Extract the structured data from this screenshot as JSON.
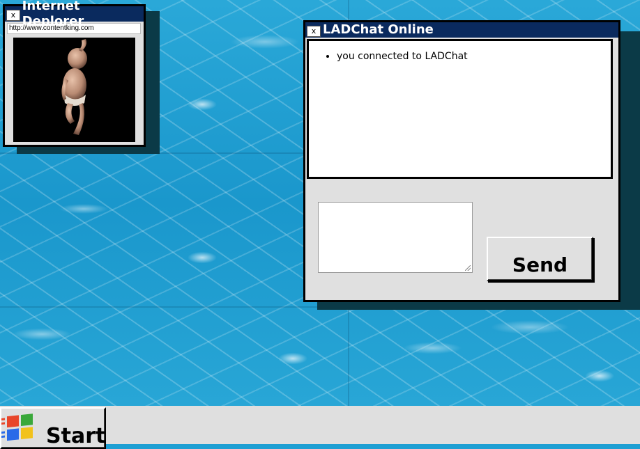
{
  "internet_deplorer": {
    "title": "Internet Deplorer",
    "close_label": "x",
    "url": "http://www.contentking.com",
    "media_icon": "dancing-baby-icon"
  },
  "ladchat": {
    "title": "LADChat Online",
    "close_label": "x",
    "messages": [
      "you connected to LADChat"
    ],
    "message_input_value": "",
    "send_label": "Send"
  },
  "taskbar": {
    "start_label": "Start",
    "start_icon": "windows-logo-icon"
  },
  "colors": {
    "titlebar": "#0a2a5e",
    "window_bg": "#e0e0e0",
    "wallpaper": "#1e9fd3"
  }
}
